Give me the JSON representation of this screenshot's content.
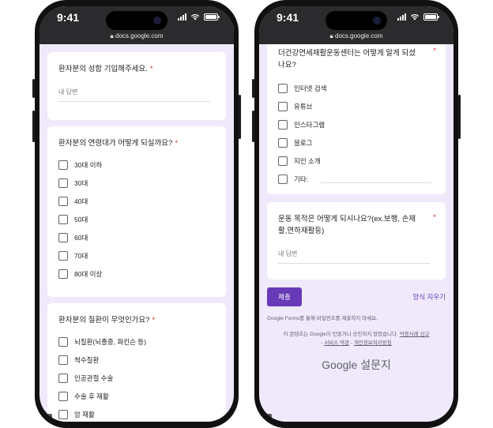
{
  "status": {
    "time": "9:41",
    "url": "docs.google.com"
  },
  "left": {
    "q_name": {
      "title": "환자분의 성함 기입해주세요.",
      "required": "*",
      "placeholder": "내 답변"
    },
    "q_age": {
      "title": "환자분의 연령대가 어떻게 되실까요?",
      "required": "*",
      "options": [
        "30대 이하",
        "30대",
        "40대",
        "50대",
        "60대",
        "70대",
        "80대 이상"
      ]
    },
    "q_disease": {
      "title": "환자분의 질환이 무엇인가요?",
      "required": "*",
      "options": [
        "뇌질환(뇌졸중, 파킨슨 등)",
        "척수질환",
        "인공관절 수술",
        "수술 후 재활",
        "암 재활"
      ]
    }
  },
  "right": {
    "q_source": {
      "title": "더건강연세재활운동센터는 어떻게 알게 되셨나요?",
      "required": "*",
      "options": [
        "인터넷 검색",
        "유튜브",
        "인스타그램",
        "블로그",
        "지인 소개",
        "기타:"
      ]
    },
    "q_goal": {
      "title": "운동 목적은 어떻게 되시나요?(ex.보행, 손재활,연하재활등)",
      "required": "*",
      "placeholder": "내 답변"
    },
    "submit_label": "제출",
    "clear_label": "양식 지우기",
    "password_notice": "Google Forms를 통해 비밀번호를 제출하지 마세요.",
    "disclaimer_text": "이 콘텐츠는 Google이 만들거나 승인하지 않았습니다.",
    "report_link": "악용사례 신고",
    "terms_link": "서비스 약관",
    "privacy_link": "개인정보처리방침",
    "separator": "-",
    "logo_text": "Google 설문지"
  }
}
